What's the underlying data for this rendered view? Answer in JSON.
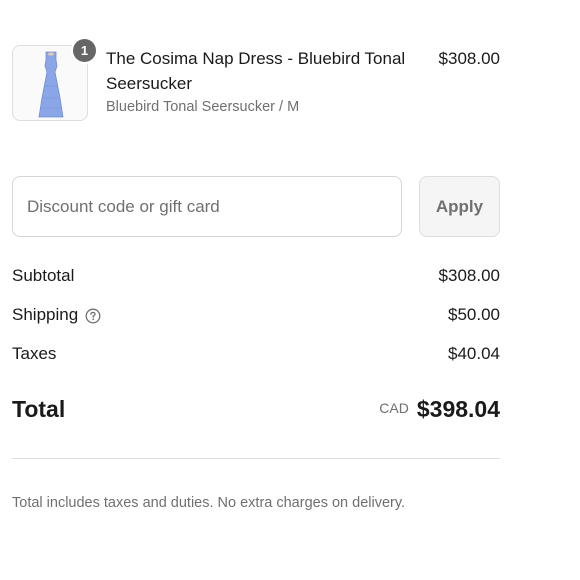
{
  "line_item": {
    "quantity": "1",
    "title": "The Cosima Nap Dress - Bluebird Tonal Seersucker",
    "variant": "Bluebird Tonal Seersucker / M",
    "price": "$308.00",
    "thumbnail_color": "#8aa6e6"
  },
  "discount": {
    "placeholder": "Discount code or gift card",
    "value": "",
    "apply_label": "Apply"
  },
  "summary": {
    "subtotal_label": "Subtotal",
    "subtotal_value": "$308.00",
    "shipping_label": "Shipping",
    "shipping_help_icon": "question-circle-icon",
    "shipping_value": "$50.00",
    "taxes_label": "Taxes",
    "taxes_value": "$40.04",
    "total_label": "Total",
    "currency": "CAD",
    "total_value": "$398.04"
  },
  "footnote": "Total includes taxes and duties. No extra charges on delivery."
}
